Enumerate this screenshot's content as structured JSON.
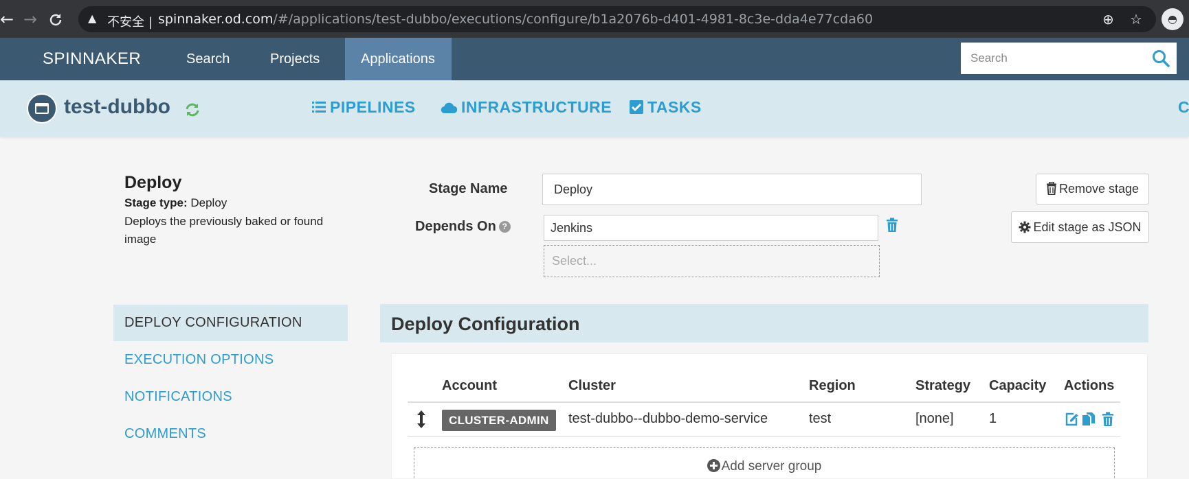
{
  "browser": {
    "back": "←",
    "forward": "→",
    "reload": "C",
    "insecure_label": "不安全 |",
    "url_host": "spinnaker.od.com",
    "url_path": "/#/applications/test-dubbo/executions/configure/b1a2076b-d401-4981-8c3e-dda4e77cda60"
  },
  "header": {
    "brand": "SPINNAKER",
    "nav": [
      "Search",
      "Projects",
      "Applications"
    ],
    "active_nav": "Applications",
    "search_placeholder": "Search"
  },
  "app": {
    "name": "test-dubbo",
    "tabs": [
      "PIPELINES",
      "INFRASTRUCTURE",
      "TASKS"
    ],
    "tab_more": "C"
  },
  "stage": {
    "title": "Deploy",
    "type_label": "Stage type:",
    "type_value": "Deploy",
    "description": "Deploys the previously baked or found image",
    "name_label": "Stage Name",
    "name_value": "Deploy",
    "depends_label": "Depends On",
    "depends_value": "Jenkins",
    "depends_placeholder": "Select...",
    "remove_button": "Remove stage",
    "edit_json_button": "Edit stage as JSON"
  },
  "side_menu": {
    "items": [
      "DEPLOY CONFIGURATION",
      "EXECUTION OPTIONS",
      "NOTIFICATIONS",
      "COMMENTS"
    ],
    "active": "DEPLOY CONFIGURATION"
  },
  "deploy_config": {
    "title": "Deploy Configuration",
    "columns": [
      "Account",
      "Cluster",
      "Region",
      "Strategy",
      "Capacity",
      "Actions"
    ],
    "rows": [
      {
        "account": "CLUSTER-ADMIN",
        "cluster": "test-dubbo--dubbo-demo-service",
        "region": "test",
        "strategy": "[none]",
        "capacity": "1"
      }
    ],
    "add_server_group": "Add server group"
  },
  "colors": {
    "header_bg": "#3b5971",
    "active_nav_bg": "#5b83a8",
    "subheader_bg": "#d7e9ef",
    "link_blue": "#2b9dd1",
    "icon_green": "#5cb85c"
  }
}
